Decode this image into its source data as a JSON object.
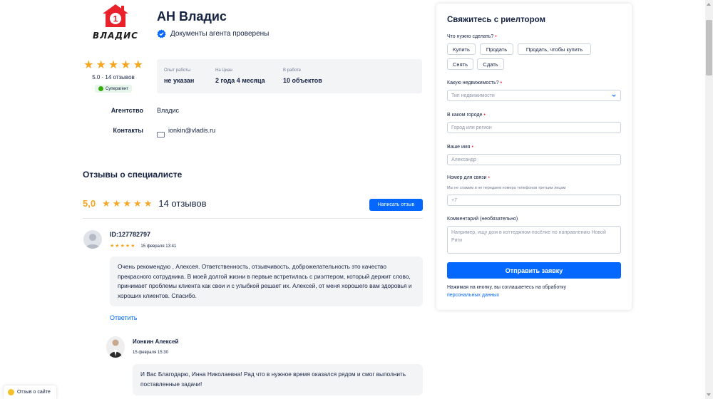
{
  "agency": {
    "logo_text": "ВЛАДИС",
    "logo_number": "1",
    "name": "АН Владис",
    "verified_text": "Документы агента проверены"
  },
  "rating": {
    "stars": 5,
    "summary": "5.0 · 14 отзывов",
    "badge": "Суперагент"
  },
  "stats": [
    {
      "label": "Опыт работы",
      "value": "не указан"
    },
    {
      "label": "На Циан",
      "value": "2 года 4 месяца"
    },
    {
      "label": "В работе",
      "value": "10 объектов"
    }
  ],
  "info": {
    "agency_label": "Агентство",
    "agency_value": "Владис",
    "contacts_label": "Контакты",
    "contacts_value": "ionkin@vladis.ru"
  },
  "reviews": {
    "title": "Отзывы о специалисте",
    "score": "5,0",
    "count": "14 отзывов",
    "write_button": "Написать отзыв",
    "items": [
      {
        "author": "ID:127782797",
        "date": "15 февраля 13:41",
        "stars": 5,
        "text": "Очень рекомендую , Алексея. Ответственность, отзывчивость, доброжелательность это качество прекрасного сотрудника. В моей долгой жизни в первые встретилась с риэлтером, который держит слово, принимает проблемы клиента как свои и с улыбкой решает их. Алексей, от меня хорошего вам здоровья и хороших клиентов. Спасибо.",
        "reply_label": "Ответить",
        "answer": {
          "author": "Ионкин Алексей",
          "date": "15 февраля 15:30",
          "text": "И Вас Благодарю, Инна Николаевна! Рад что в нужное время оказался рядом и смог выполнить поставленные задачи!"
        }
      }
    ]
  },
  "form": {
    "title": "Свяжитесь с риелтором",
    "action_label": "Что нужно сделать?",
    "actions": [
      "Купить",
      "Продать",
      "Продать, чтобы купить",
      "Снять",
      "Сдать"
    ],
    "property_label": "Какую недвижимость?",
    "property_placeholder": "Тип недвижимости",
    "city_label": "В каком городе",
    "city_placeholder": "Город или регион",
    "name_label": "Ваше имя",
    "name_placeholder": "Александр",
    "phone_label": "Номер для связи",
    "phone_hint": "Мы не спамим и не передаем номера телефонов третьим лицам",
    "phone_placeholder": "+7",
    "comment_label": "Комментарий (необязательно)",
    "comment_placeholder": "Например, ищу дом в коттеджном посёлке по направлению Новой Риги",
    "submit": "Отправить заявку",
    "consent_text": "Нажимая на кнопку, вы соглашаетесь на обработку",
    "consent_link": "персональных данных"
  },
  "floating": {
    "site_review": "Отзыв о сайте"
  },
  "colors": {
    "primary": "#0468ff",
    "star": "#f5a623",
    "text": "#152242",
    "required": "#ff1f34",
    "logo_red": "#e8212b"
  }
}
